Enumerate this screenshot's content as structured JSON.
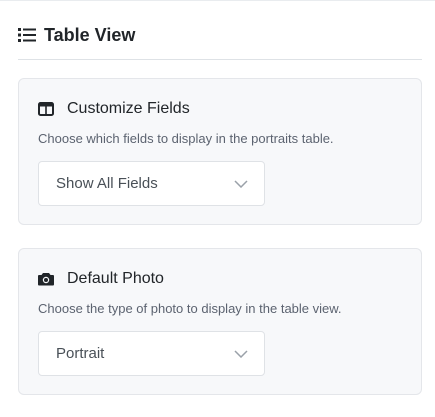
{
  "header": {
    "title": "Table View",
    "icon": "list-icon"
  },
  "cards": [
    {
      "icon": "table-columns-icon",
      "title": "Customize Fields",
      "description": "Choose which fields to display in the portraits table.",
      "select_value": "Show All Fields"
    },
    {
      "icon": "camera-icon",
      "title": "Default Photo",
      "description": "Choose the type of photo to display in the table view.",
      "select_value": "Portrait"
    }
  ],
  "colors": {
    "card_bg": "#f7f8fa",
    "card_border": "#e4e6ea",
    "text": "#212529",
    "muted": "#5c6370"
  }
}
